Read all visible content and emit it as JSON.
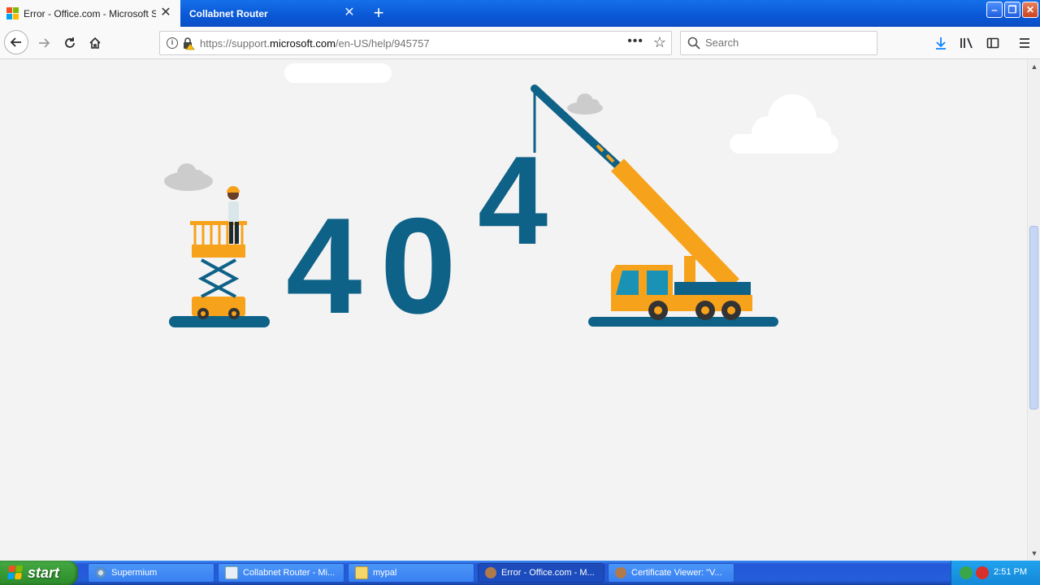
{
  "browser": {
    "tabs": [
      {
        "label": "Error - Office.com - Microsoft Supp",
        "active": true,
        "icon": "microsoft-logo-icon"
      },
      {
        "label": "Collabnet Router",
        "active": false
      }
    ],
    "url": {
      "scheme": "https://support.",
      "host": "microsoft.com",
      "path": "/en-US/help/945757"
    },
    "search_placeholder": "Search",
    "icons": [
      "back-arrow-icon",
      "forward-arrow-icon",
      "reload-icon",
      "home-icon",
      "info-icon",
      "lock-warning-icon",
      "more-dots-icon",
      "star-icon",
      "search-icon",
      "download-icon",
      "library-icon",
      "sidebar-icon",
      "menu-icon"
    ]
  },
  "page": {
    "error_digits": [
      "4",
      "0",
      "4"
    ],
    "colors": {
      "digit": "#0e6187",
      "crane": "#f7a21b",
      "ground": "#0e6187"
    }
  },
  "taskbar": {
    "start_label": "start",
    "items": [
      {
        "label": "Supermium",
        "active": false
      },
      {
        "label": "Collabnet Router - Mi...",
        "active": false
      },
      {
        "label": "mypal",
        "active": false
      },
      {
        "label": "Error - Office.com - M...",
        "active": true
      },
      {
        "label": "Certificate Viewer: \"V...",
        "active": false
      }
    ],
    "clock": "2:51 PM"
  }
}
